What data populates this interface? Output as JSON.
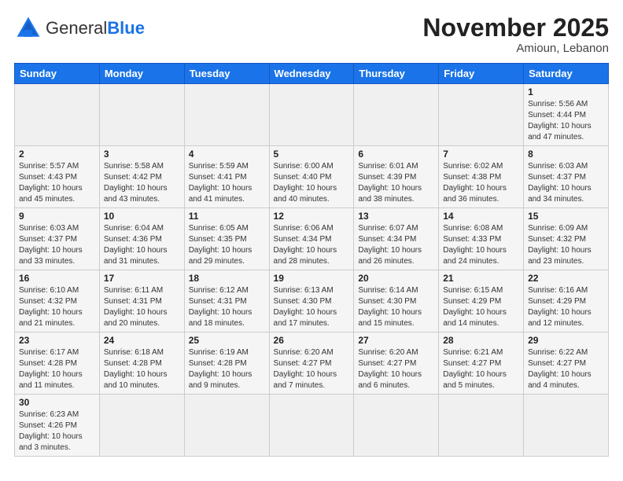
{
  "logo": {
    "text_general": "General",
    "text_blue": "Blue"
  },
  "header": {
    "month_year": "November 2025",
    "location": "Amioun, Lebanon"
  },
  "weekdays": [
    "Sunday",
    "Monday",
    "Tuesday",
    "Wednesday",
    "Thursday",
    "Friday",
    "Saturday"
  ],
  "weeks": [
    [
      {
        "day": "",
        "info": ""
      },
      {
        "day": "",
        "info": ""
      },
      {
        "day": "",
        "info": ""
      },
      {
        "day": "",
        "info": ""
      },
      {
        "day": "",
        "info": ""
      },
      {
        "day": "",
        "info": ""
      },
      {
        "day": "1",
        "info": "Sunrise: 5:56 AM\nSunset: 4:44 PM\nDaylight: 10 hours\nand 47 minutes."
      }
    ],
    [
      {
        "day": "2",
        "info": "Sunrise: 5:57 AM\nSunset: 4:43 PM\nDaylight: 10 hours\nand 45 minutes."
      },
      {
        "day": "3",
        "info": "Sunrise: 5:58 AM\nSunset: 4:42 PM\nDaylight: 10 hours\nand 43 minutes."
      },
      {
        "day": "4",
        "info": "Sunrise: 5:59 AM\nSunset: 4:41 PM\nDaylight: 10 hours\nand 41 minutes."
      },
      {
        "day": "5",
        "info": "Sunrise: 6:00 AM\nSunset: 4:40 PM\nDaylight: 10 hours\nand 40 minutes."
      },
      {
        "day": "6",
        "info": "Sunrise: 6:01 AM\nSunset: 4:39 PM\nDaylight: 10 hours\nand 38 minutes."
      },
      {
        "day": "7",
        "info": "Sunrise: 6:02 AM\nSunset: 4:38 PM\nDaylight: 10 hours\nand 36 minutes."
      },
      {
        "day": "8",
        "info": "Sunrise: 6:03 AM\nSunset: 4:37 PM\nDaylight: 10 hours\nand 34 minutes."
      }
    ],
    [
      {
        "day": "9",
        "info": "Sunrise: 6:03 AM\nSunset: 4:37 PM\nDaylight: 10 hours\nand 33 minutes."
      },
      {
        "day": "10",
        "info": "Sunrise: 6:04 AM\nSunset: 4:36 PM\nDaylight: 10 hours\nand 31 minutes."
      },
      {
        "day": "11",
        "info": "Sunrise: 6:05 AM\nSunset: 4:35 PM\nDaylight: 10 hours\nand 29 minutes."
      },
      {
        "day": "12",
        "info": "Sunrise: 6:06 AM\nSunset: 4:34 PM\nDaylight: 10 hours\nand 28 minutes."
      },
      {
        "day": "13",
        "info": "Sunrise: 6:07 AM\nSunset: 4:34 PM\nDaylight: 10 hours\nand 26 minutes."
      },
      {
        "day": "14",
        "info": "Sunrise: 6:08 AM\nSunset: 4:33 PM\nDaylight: 10 hours\nand 24 minutes."
      },
      {
        "day": "15",
        "info": "Sunrise: 6:09 AM\nSunset: 4:32 PM\nDaylight: 10 hours\nand 23 minutes."
      }
    ],
    [
      {
        "day": "16",
        "info": "Sunrise: 6:10 AM\nSunset: 4:32 PM\nDaylight: 10 hours\nand 21 minutes."
      },
      {
        "day": "17",
        "info": "Sunrise: 6:11 AM\nSunset: 4:31 PM\nDaylight: 10 hours\nand 20 minutes."
      },
      {
        "day": "18",
        "info": "Sunrise: 6:12 AM\nSunset: 4:31 PM\nDaylight: 10 hours\nand 18 minutes."
      },
      {
        "day": "19",
        "info": "Sunrise: 6:13 AM\nSunset: 4:30 PM\nDaylight: 10 hours\nand 17 minutes."
      },
      {
        "day": "20",
        "info": "Sunrise: 6:14 AM\nSunset: 4:30 PM\nDaylight: 10 hours\nand 15 minutes."
      },
      {
        "day": "21",
        "info": "Sunrise: 6:15 AM\nSunset: 4:29 PM\nDaylight: 10 hours\nand 14 minutes."
      },
      {
        "day": "22",
        "info": "Sunrise: 6:16 AM\nSunset: 4:29 PM\nDaylight: 10 hours\nand 12 minutes."
      }
    ],
    [
      {
        "day": "23",
        "info": "Sunrise: 6:17 AM\nSunset: 4:28 PM\nDaylight: 10 hours\nand 11 minutes."
      },
      {
        "day": "24",
        "info": "Sunrise: 6:18 AM\nSunset: 4:28 PM\nDaylight: 10 hours\nand 10 minutes."
      },
      {
        "day": "25",
        "info": "Sunrise: 6:19 AM\nSunset: 4:28 PM\nDaylight: 10 hours\nand 9 minutes."
      },
      {
        "day": "26",
        "info": "Sunrise: 6:20 AM\nSunset: 4:27 PM\nDaylight: 10 hours\nand 7 minutes."
      },
      {
        "day": "27",
        "info": "Sunrise: 6:20 AM\nSunset: 4:27 PM\nDaylight: 10 hours\nand 6 minutes."
      },
      {
        "day": "28",
        "info": "Sunrise: 6:21 AM\nSunset: 4:27 PM\nDaylight: 10 hours\nand 5 minutes."
      },
      {
        "day": "29",
        "info": "Sunrise: 6:22 AM\nSunset: 4:27 PM\nDaylight: 10 hours\nand 4 minutes."
      }
    ],
    [
      {
        "day": "30",
        "info": "Sunrise: 6:23 AM\nSunset: 4:26 PM\nDaylight: 10 hours\nand 3 minutes."
      },
      {
        "day": "",
        "info": ""
      },
      {
        "day": "",
        "info": ""
      },
      {
        "day": "",
        "info": ""
      },
      {
        "day": "",
        "info": ""
      },
      {
        "day": "",
        "info": ""
      },
      {
        "day": "",
        "info": ""
      }
    ]
  ]
}
